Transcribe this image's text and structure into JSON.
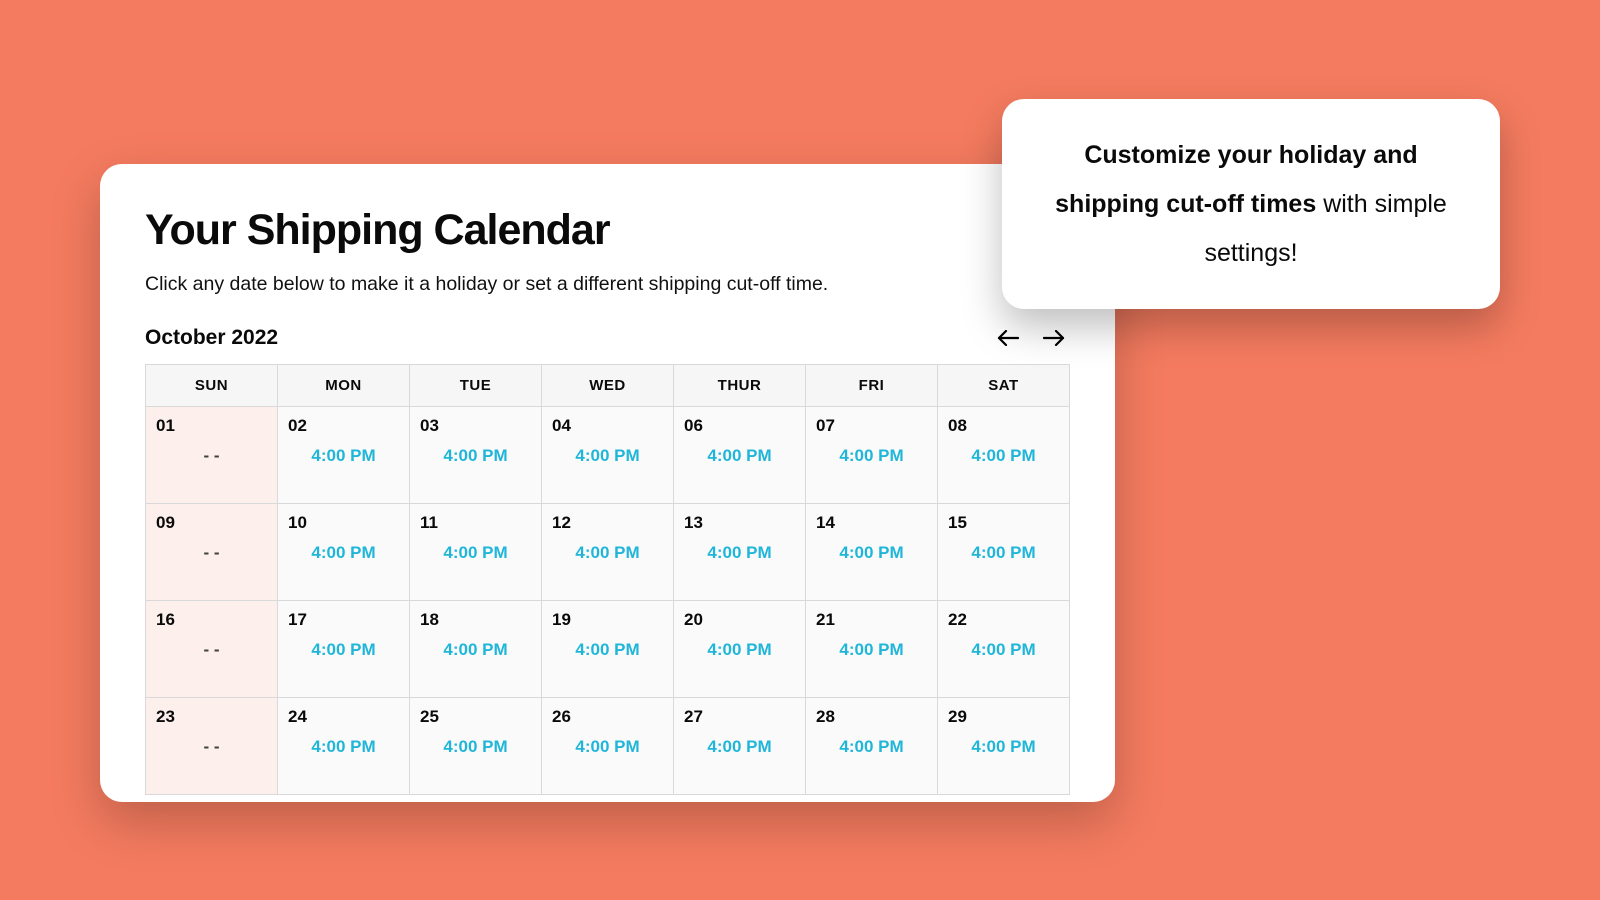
{
  "card": {
    "title": "Your Shipping Calendar",
    "desc": "Click any date below to make it a holiday or set a different shipping cut-off time.",
    "month": "October 2022"
  },
  "days": [
    "SUN",
    "MON",
    "TUE",
    "WED",
    "THUR",
    "FRI",
    "SAT"
  ],
  "weeks": [
    [
      {
        "num": "01",
        "time": "- -",
        "sun": true
      },
      {
        "num": "02",
        "time": "4:00 PM"
      },
      {
        "num": "03",
        "time": "4:00 PM"
      },
      {
        "num": "04",
        "time": "4:00 PM"
      },
      {
        "num": "06",
        "time": "4:00 PM"
      },
      {
        "num": "07",
        "time": "4:00 PM"
      },
      {
        "num": "08",
        "time": "4:00 PM"
      }
    ],
    [
      {
        "num": "09",
        "time": "- -",
        "sun": true
      },
      {
        "num": "10",
        "time": "4:00 PM"
      },
      {
        "num": "11",
        "time": "4:00 PM"
      },
      {
        "num": "12",
        "time": "4:00 PM"
      },
      {
        "num": "13",
        "time": "4:00 PM"
      },
      {
        "num": "14",
        "time": "4:00 PM"
      },
      {
        "num": "15",
        "time": "4:00 PM"
      }
    ],
    [
      {
        "num": "16",
        "time": "- -",
        "sun": true
      },
      {
        "num": "17",
        "time": "4:00 PM"
      },
      {
        "num": "18",
        "time": "4:00 PM"
      },
      {
        "num": "19",
        "time": "4:00 PM"
      },
      {
        "num": "20",
        "time": "4:00 PM"
      },
      {
        "num": "21",
        "time": "4:00 PM"
      },
      {
        "num": "22",
        "time": "4:00 PM"
      }
    ],
    [
      {
        "num": "23",
        "time": "- -",
        "sun": true
      },
      {
        "num": "24",
        "time": "4:00 PM"
      },
      {
        "num": "25",
        "time": "4:00 PM"
      },
      {
        "num": "26",
        "time": "4:00 PM"
      },
      {
        "num": "27",
        "time": "4:00 PM"
      },
      {
        "num": "28",
        "time": "4:00 PM"
      },
      {
        "num": "29",
        "time": "4:00 PM"
      }
    ]
  ],
  "callout": {
    "bold": "Customize your holiday and shipping cut-off times",
    "rest": " with simple settings!"
  }
}
